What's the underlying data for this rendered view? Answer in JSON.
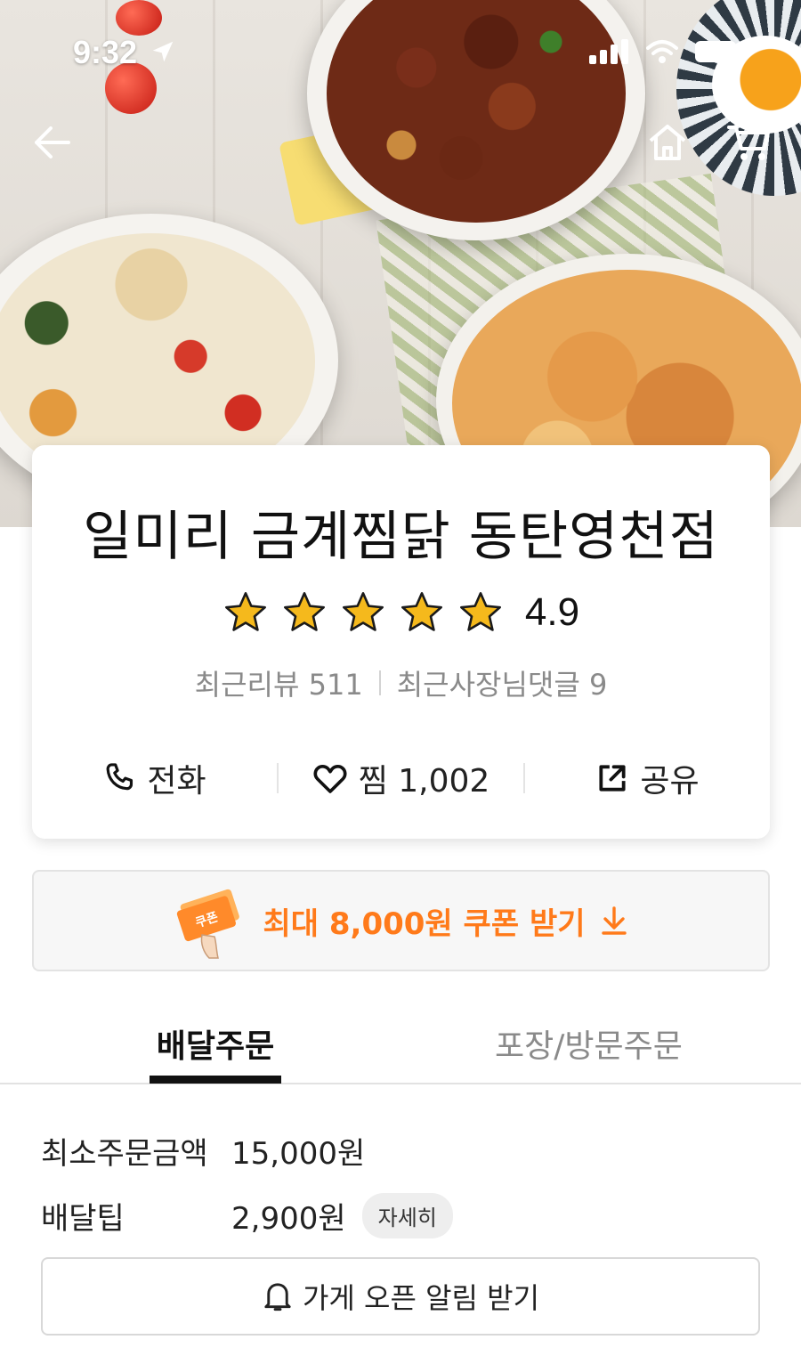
{
  "status_bar": {
    "time": "9:32"
  },
  "store": {
    "name": "일미리 금계찜닭 동탄영천점",
    "rating": "4.9",
    "stars": 5,
    "recent_reviews_label": "최근리뷰 511",
    "owner_replies_label": "최근사장님댓글 9"
  },
  "actions": {
    "call_label": "전화",
    "favorite_label": "찜 1,002",
    "share_label": "공유"
  },
  "coupon": {
    "badge_text": "쿠폰",
    "label": "최대 8,000원 쿠폰 받기"
  },
  "tabs": [
    {
      "label": "배달주문",
      "active": true
    },
    {
      "label": "포장/방문주문",
      "active": false
    }
  ],
  "delivery_info": {
    "min_order_label": "최소주문금액",
    "min_order_value": "15,000원",
    "tip_label": "배달팁",
    "tip_value": "2,900원",
    "detail_label": "자세히"
  },
  "notify_button": {
    "label": "가게 오픈 알림 받기"
  },
  "colors": {
    "accent": "#ff7a1a",
    "star": "#f5b91c",
    "text": "#111111",
    "muted": "#8a8a8a"
  },
  "icons": [
    "back-arrow-icon",
    "home-icon",
    "cart-icon",
    "phone-icon",
    "heart-icon",
    "share-icon",
    "download-arrow-icon",
    "bell-icon",
    "location-arrow-icon",
    "signal-icon",
    "wifi-icon",
    "battery-icon"
  ]
}
